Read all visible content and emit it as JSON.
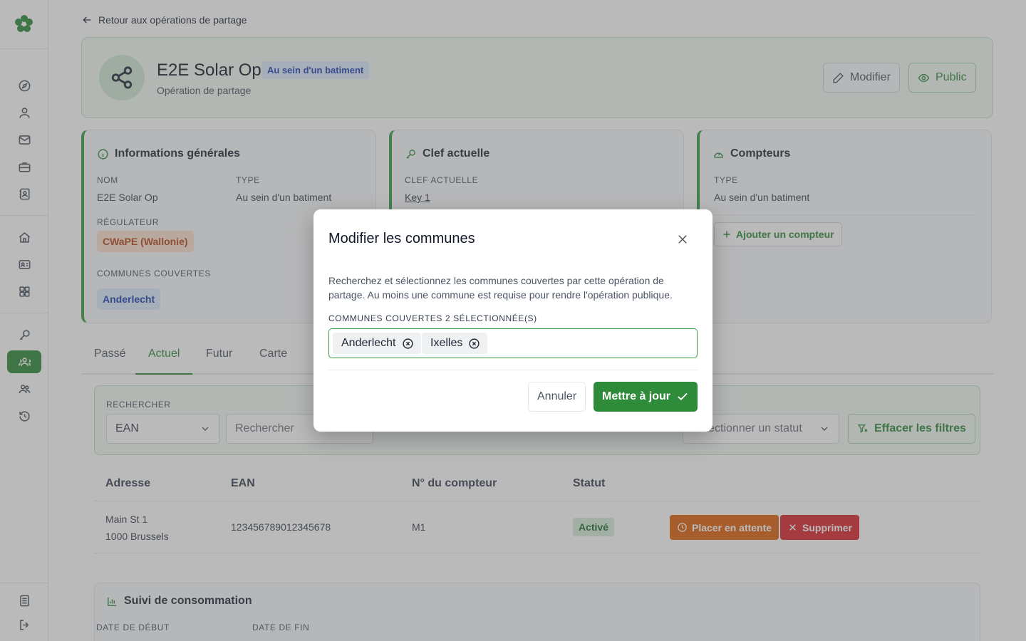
{
  "nav": {
    "back_label": "Retour aux opérations de partage",
    "icons": [
      "compass-icon",
      "user-icon",
      "mail-icon",
      "briefcase-icon",
      "contact-book-icon",
      "home-icon",
      "id-card-icon",
      "apps-icon",
      "key-icon",
      "community-icon",
      "group-icon",
      "history-icon",
      "document-icon",
      "logout-icon"
    ]
  },
  "header": {
    "title": "E2E Solar Op",
    "badge": "Au sein d'un batiment",
    "subtitle": "Opération de partage",
    "edit_label": "Modifier",
    "public_label": "Public"
  },
  "general": {
    "title": "Informations générales",
    "name_label": "NOM",
    "name_value": "E2E Solar Op",
    "type_label": "TYPE",
    "type_value": "Au sein d'un batiment",
    "regulator_label": "RÉGULATEUR",
    "regulator_value": "CWaPE (Wallonie)",
    "communes_label": "COMMUNES COUVERTES",
    "communes_value": "Anderlecht"
  },
  "key": {
    "title": "Clef actuelle",
    "label": "CLEF ACTUELLE",
    "value": "Key 1"
  },
  "meters": {
    "title": "Compteurs",
    "type_label": "TYPE",
    "type_value": "Au sein d'un batiment",
    "add_label": "Ajouter un compteur"
  },
  "tabs": [
    "Passé",
    "Actuel",
    "Futur",
    "Carte"
  ],
  "filter": {
    "search_label": "RECHERCHER",
    "field_value": "EAN",
    "search_placeholder": "Rechercher",
    "status_placeholder": "Sélectionner un statut",
    "clear_label": "Effacer les filtres"
  },
  "table": {
    "headers": [
      "Adresse",
      "EAN",
      "N° du compteur",
      "Statut"
    ],
    "rows": [
      {
        "address_line1": "Main St 1",
        "address_line2": "1000 Brussels",
        "ean": "123456789012345678",
        "meter": "M1",
        "status": "Activé",
        "wait_label": "Placer en attente",
        "delete_label": "Supprimer"
      }
    ]
  },
  "consumption": {
    "title": "Suivi de consommation",
    "start_label": "DATE DE DÉBUT",
    "end_label": "DATE DE FIN"
  },
  "modal": {
    "title": "Modifier les communes",
    "description": "Recherchez et sélectionnez les communes couvertes par cette opération de partage. Au moins une commune est requise pour rendre l'opération publique.",
    "field_label": "COMMUNES COUVERTES 2 SÉLECTIONNÉE(S)",
    "chips": [
      "Anderlecht",
      "Ixelles"
    ],
    "cancel_label": "Annuler",
    "submit_label": "Mettre à jour"
  },
  "colors": {
    "primary": "#2e8b3a",
    "orange": "#e0600b",
    "red": "#d9252c",
    "badge_blue": "#dbeafe"
  }
}
